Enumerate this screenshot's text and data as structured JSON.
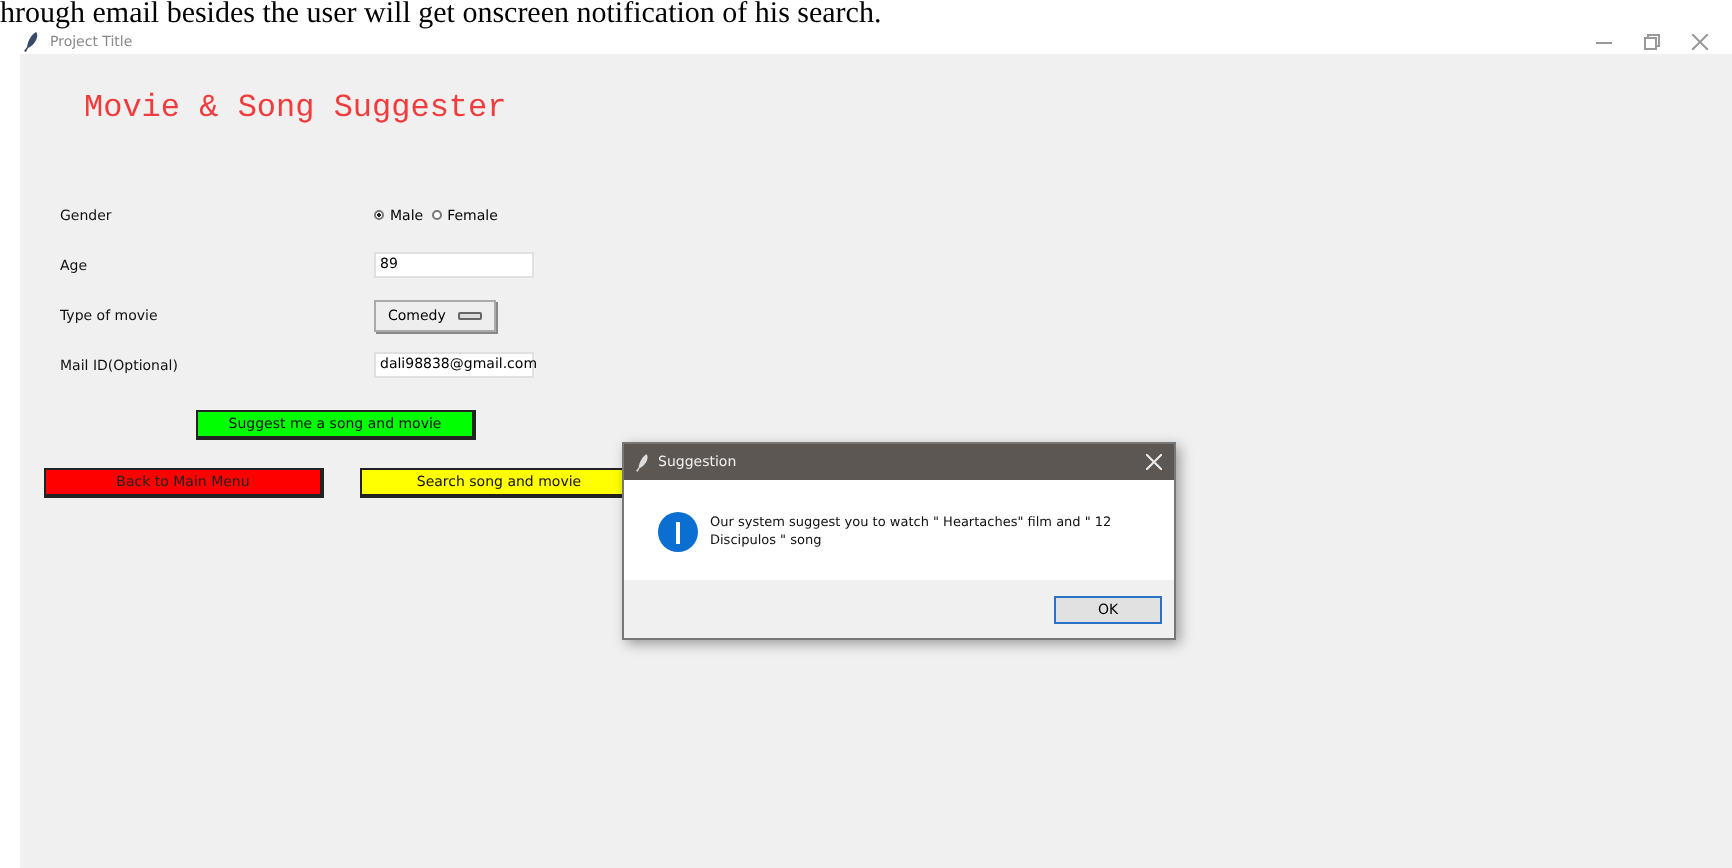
{
  "document_text": "hrough email besides the user will get onscreen notification of his search.",
  "window": {
    "title": "Project Title"
  },
  "app_title": "Movie & Song Suggester",
  "form": [
    {
      "kind": "radio",
      "label": "Gender",
      "options": [
        {
          "label": "Male",
          "selected": true
        },
        {
          "label": "Female",
          "selected": false
        }
      ]
    },
    {
      "kind": "entry",
      "label": "Age",
      "value": "89"
    },
    {
      "kind": "menu",
      "label": "Type of movie",
      "value": "Comedy"
    },
    {
      "kind": "entry",
      "label": "Mail ID(Optional)",
      "value": "dali98838@gmail.com"
    }
  ],
  "suggest_button": "Suggest me a song and movie",
  "back_button": "Back to Main Menu",
  "search_button": "Search song and movie",
  "dialog": {
    "title": "Suggestion",
    "message": "Our system suggest you to watch \" Heartaches\"  film and \" 12 Discipulos \" song",
    "button": "OK"
  }
}
